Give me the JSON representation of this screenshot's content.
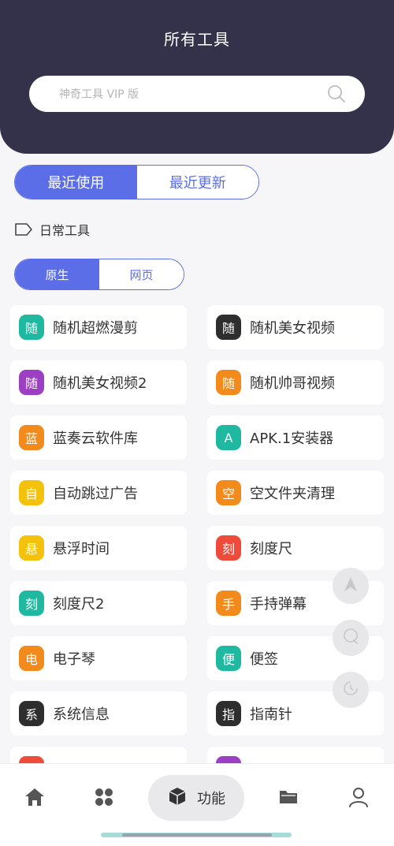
{
  "header": {
    "title": "所有工具"
  },
  "search": {
    "placeholder": "神奇工具 VIP 版"
  },
  "tabs": {
    "recent": "最近使用",
    "updated": "最近更新"
  },
  "category": {
    "label": "日常工具"
  },
  "subtabs": {
    "native": "原生",
    "web": "网页"
  },
  "tools": [
    {
      "badge": "随",
      "label": "随机超燃漫剪",
      "color": "#1fb8a0"
    },
    {
      "badge": "随",
      "label": "随机美女视频",
      "color": "#2e2e2e"
    },
    {
      "badge": "随",
      "label": "随机美女视频2",
      "color": "#9c3fc2"
    },
    {
      "badge": "随",
      "label": "随机帅哥视频",
      "color": "#f28a1c"
    },
    {
      "badge": "蓝",
      "label": "蓝奏云软件库",
      "color": "#f28a1c"
    },
    {
      "badge": "A",
      "label": "APK.1安装器",
      "color": "#1fb8a0"
    },
    {
      "badge": "自",
      "label": "自动跳过广告",
      "color": "#f4c20d"
    },
    {
      "badge": "空",
      "label": "空文件夹清理",
      "color": "#f28a1c"
    },
    {
      "badge": "悬",
      "label": "悬浮时间",
      "color": "#f4c20d"
    },
    {
      "badge": "刻",
      "label": "刻度尺",
      "color": "#ee4b3a"
    },
    {
      "badge": "刻",
      "label": "刻度尺2",
      "color": "#1fb8a0"
    },
    {
      "badge": "手",
      "label": "手持弹幕",
      "color": "#f28a1c"
    },
    {
      "badge": "电",
      "label": "电子琴",
      "color": "#f28a1c"
    },
    {
      "badge": "便",
      "label": "便签",
      "color": "#1fb8a0"
    },
    {
      "badge": "系",
      "label": "系统信息",
      "color": "#2e2e2e"
    },
    {
      "badge": "指",
      "label": "指南针",
      "color": "#2e2e2e"
    },
    {
      "badge": "",
      "label": "",
      "color": "#ee4b3a"
    },
    {
      "badge": "",
      "label": "",
      "color": "#9c3fc2"
    }
  ],
  "bottom_nav": {
    "center_label": "功能"
  },
  "colors": {
    "accent": "#5b6ee8",
    "header_bg": "#33324a"
  }
}
